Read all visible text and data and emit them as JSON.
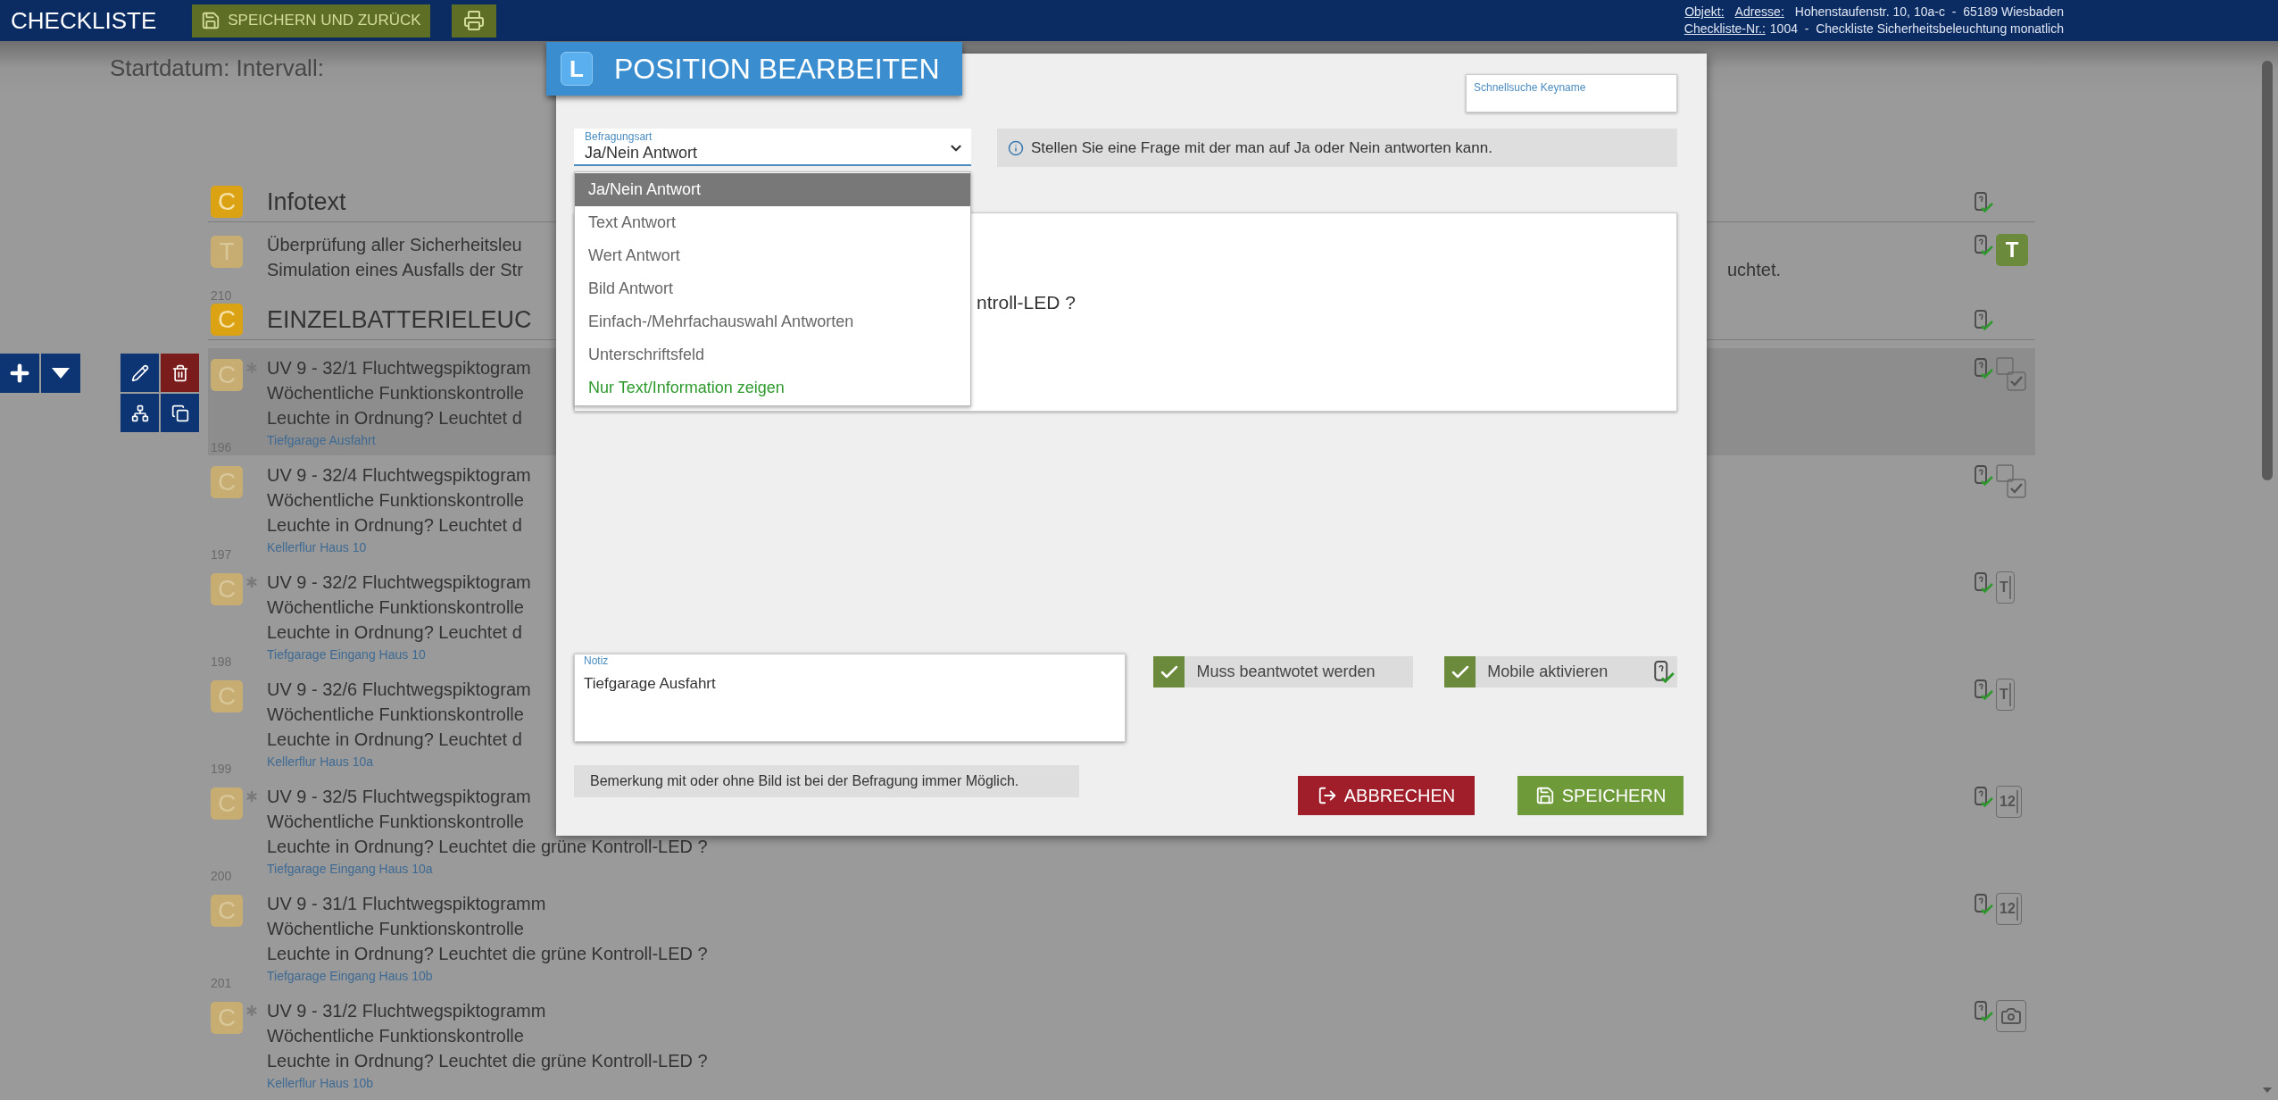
{
  "top_bar": {
    "title": "CHECKLISTE",
    "save_button": "SPEICHERN UND ZURÜCK",
    "object_label": "Objekt:",
    "address_label": "Adresse:",
    "address": "Hohenstaufenstr. 10, 10a-c  -  65189 Wiesbaden",
    "checklist_label": "Checkliste-Nr.:",
    "checklist": "1004  -  Checkliste Sicherheitsbeleuchtung monatlich"
  },
  "header": {
    "text": "Startdatum: Intervall:"
  },
  "items": [
    {
      "kind": "section",
      "badge": "C",
      "title": "Infotext"
    },
    {
      "kind": "entry",
      "badge": "T",
      "starred": false,
      "selected": false,
      "lines": [
        {
          "text": "Überprüfung aller Sicherheitsleu"
        },
        {
          "text": "Simulation eines Ausfalls der Str",
          "tail": "uchtet."
        }
      ],
      "number": "210",
      "type_icon": {
        "kind": "info",
        "label": "T"
      }
    },
    {
      "kind": "section",
      "badge": "C",
      "title": "EINZELBATTERIELEUC"
    },
    {
      "kind": "entry",
      "badge": "C",
      "starred": true,
      "selected": true,
      "lines": [
        {
          "text": "UV 9 - 32/1 Fluchtwegspiktogram"
        },
        {
          "text": "Wöchentliche Funktionskontrolle"
        },
        {
          "text": "Leuchte in Ordnung? Leuchtet d"
        }
      ],
      "location": "Tiefgarage Ausfahrt",
      "number": "196",
      "type_icon": {
        "kind": "checkbox"
      }
    },
    {
      "kind": "entry",
      "badge": "C",
      "starred": false,
      "selected": false,
      "lines": [
        {
          "text": "UV 9 - 32/4 Fluchtwegspiktogram"
        },
        {
          "text": "Wöchentliche Funktionskontrolle"
        },
        {
          "text": "Leuchte in Ordnung? Leuchtet d"
        }
      ],
      "location": "Kellerflur Haus 10",
      "number": "197",
      "type_icon": {
        "kind": "checkbox"
      }
    },
    {
      "kind": "entry",
      "badge": "C",
      "starred": true,
      "selected": false,
      "lines": [
        {
          "text": "UV 9 - 32/2 Fluchtwegspiktogram"
        },
        {
          "text": "Wöchentliche Funktionskontrolle"
        },
        {
          "text": "Leuchte in Ordnung? Leuchtet d"
        }
      ],
      "location": "Tiefgarage Eingang Haus 10",
      "number": "198",
      "type_icon": {
        "kind": "text",
        "label": "T"
      }
    },
    {
      "kind": "entry",
      "badge": "C",
      "starred": false,
      "selected": false,
      "lines": [
        {
          "text": "UV 9 - 32/6 Fluchtwegspiktogram"
        },
        {
          "text": "Wöchentliche Funktionskontrolle"
        },
        {
          "text": "Leuchte in Ordnung? Leuchtet d"
        }
      ],
      "location": "Kellerflur Haus 10a",
      "number": "199",
      "type_icon": {
        "kind": "text",
        "label": "T"
      }
    },
    {
      "kind": "entry",
      "badge": "C",
      "starred": true,
      "selected": false,
      "lines": [
        {
          "text": "UV 9 - 32/5 Fluchtwegspiktogram"
        },
        {
          "text": "Wöchentliche Funktionskontrolle"
        },
        {
          "text": "Leuchte in Ordnung? Leuchtet die grüne Kontroll-LED ?"
        }
      ],
      "location": "Tiefgarage Eingang Haus 10a",
      "number": "200",
      "type_icon": {
        "kind": "number",
        "label": "12"
      }
    },
    {
      "kind": "entry",
      "badge": "C",
      "starred": false,
      "selected": false,
      "lines": [
        {
          "text": "UV 9 - 31/1 Fluchtwegspiktogramm"
        },
        {
          "text": "Wöchentliche Funktionskontrolle"
        },
        {
          "text": "Leuchte in Ordnung? Leuchtet die grüne Kontroll-LED ?"
        }
      ],
      "location": "Tiefgarage Eingang Haus 10b",
      "number": "201",
      "type_icon": {
        "kind": "number",
        "label": "12"
      }
    },
    {
      "kind": "entry",
      "badge": "C",
      "starred": true,
      "selected": false,
      "lines": [
        {
          "text": "UV 9 - 31/2 Fluchtwegspiktogramm"
        },
        {
          "text": "Wöchentliche Funktionskontrolle"
        },
        {
          "text": "Leuchte in Ordnung? Leuchtet die grüne Kontroll-LED ?"
        }
      ],
      "location": "Kellerflur Haus 10b",
      "type_icon": {
        "kind": "camera"
      }
    }
  ],
  "modal": {
    "badge": "L",
    "title": "POSITION BEARBEITEN",
    "quick_search": {
      "label": "Schnellsuche Keyname"
    },
    "question_type": {
      "label": "Befragungsart",
      "value": "Ja/Nein Antwort",
      "expanded": true,
      "options": [
        {
          "label": "Ja/Nein Antwort",
          "selected": true,
          "kind": "answer"
        },
        {
          "label": "Text Antwort",
          "selected": false,
          "kind": "answer"
        },
        {
          "label": "Wert Antwort",
          "selected": false,
          "kind": "answer"
        },
        {
          "label": "Bild Antwort",
          "selected": false,
          "kind": "answer"
        },
        {
          "label": "Einfach-/Mehrfachauswahl Antworten",
          "selected": false,
          "kind": "answer"
        },
        {
          "label": "Unterschriftsfeld",
          "selected": false,
          "kind": "answer"
        },
        {
          "label": "Nur Text/Information zeigen",
          "selected": false,
          "kind": "info"
        }
      ]
    },
    "hint": "Stellen Sie eine Frage mit der man auf Ja oder Nein antworten kann.",
    "question_text": "ntroll-LED ?",
    "note": {
      "label": "Notiz",
      "value": "Tiefgarage Ausfahrt"
    },
    "checkboxes": [
      {
        "label": "Muss beantwotet werden",
        "checked": true,
        "kind": "plain"
      },
      {
        "label": "Mobile aktivieren",
        "checked": true,
        "kind": "mobile"
      }
    ],
    "remark": "Bemerkung mit oder ohne Bild ist bei der Befragung immer Möglich.",
    "buttons": [
      {
        "label": "ABBRECHEN",
        "kind": "cancel"
      },
      {
        "label": "SPEICHERN",
        "kind": "save"
      }
    ]
  }
}
